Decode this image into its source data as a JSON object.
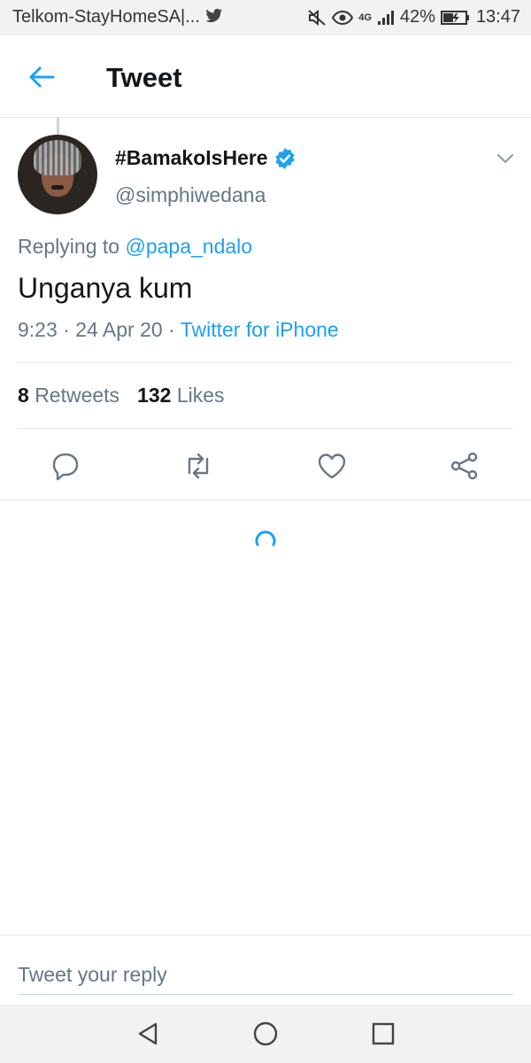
{
  "status_bar": {
    "carrier": "Telkom-StayHomeSA|...",
    "network": "4G",
    "battery": "42%",
    "time": "13:47"
  },
  "header": {
    "title": "Tweet"
  },
  "tweet": {
    "display_name": "#BamakoIsHere",
    "username": "@simphiwedana",
    "replying_prefix": "Replying to",
    "replying_to": "@papa_ndalo",
    "text": "Unganya kum",
    "timestamp": "9:23 · 24 Apr 20 ·",
    "source": "Twitter for iPhone",
    "retweets_count": "8",
    "retweets_label": "Retweets",
    "likes_count": "132",
    "likes_label": "Likes"
  },
  "reply": {
    "placeholder": "Tweet your reply"
  },
  "colors": {
    "accent": "#1da1f2",
    "secondary_text": "#657786",
    "divider": "#e1e8ed"
  }
}
